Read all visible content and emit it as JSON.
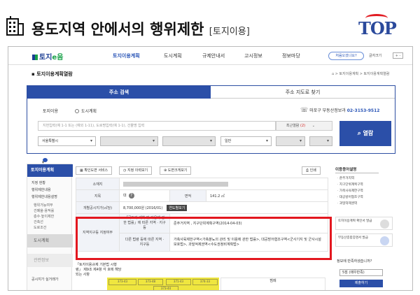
{
  "slide": {
    "title": "용도지역 안에서의 행위제한",
    "subtitle": "[토지이용]",
    "logo": "TOP"
  },
  "nav": {
    "brand_a": "토지",
    "brand_b": "e음",
    "menus": [
      "토지이용계획",
      "도시계획",
      "규제안내서",
      "고시정보",
      "정보마당"
    ],
    "active_menu": "토지이용계획",
    "pill": "처음오셨나요?",
    "font_label": "글자크기",
    "font_ctrl": "+ -"
  },
  "page": {
    "title": "토지이용계획열람",
    "breadcrumb": "⌂ > 토지이용계획 > 토지이용계획열람"
  },
  "search": {
    "tab_active": "주소 검색",
    "tab_other": "주소 지도로 찾기",
    "radio_1": "토지이용",
    "radio_2": "도시계획",
    "phone_label": "마포구 부동산정보과",
    "phone_number": "02-3153-9512",
    "address_placeholder": "지번입력(예 1-1 또는 (예외 1-11), 도로명입력(예 1-1), 건물명 입력",
    "recent_label": "최근열람",
    "recent_count": "(2)",
    "city": "서울특별시",
    "land_type": "일반",
    "button": "열람"
  },
  "sidebar": {
    "head": "토지이용계획",
    "items": [
      "지정 현황",
      "행위제한내용",
      "행위제한내용설명"
    ],
    "subitems": [
      "행위가능여부",
      "건폐율·용적률",
      "층수·높이제한",
      "건축선",
      "도로조건"
    ],
    "box_1": "도시계획",
    "box_2": "관련정보",
    "bottom": "공시지가 실거래가"
  },
  "toolbar": {
    "btn_1": "확인도면 서비스",
    "btn_2": "지정 이력보기",
    "btn_3": "도면크게보기",
    "print": "인쇄"
  },
  "info": {
    "row_addr_label": "소재지",
    "row_jimok_label": "지목",
    "jimok_value": "대",
    "area_label": "면적",
    "area_value": "141.2 ㎡",
    "price_label": "개별공시지가(㎡당)",
    "price_value": "8,700,000원 (2016/01)",
    "price_btn": "연도별보기",
    "usage_label": "지역지구등 지정여부",
    "law1_label": "「국토의 계획 및 이용에 관한 법률」에 따른 지역 · 지구등",
    "law1_value": "준주거지역 , 지구단위계획구역(2014-04-03)",
    "law2_label": "다른 법령 등에 따른 지역 · 지구등",
    "law2_value": "가축사육제한구역<가축분뇨의 관리 및 이용에 관한 법률>, 대공방어협조구역<군사기지 및 군사시설 보호법>, 과밀억제권역<수도권정비계획법>"
  },
  "legend": "「토지이용규제 기본법 시행령」 제9조 제4항 각 호에 해당되는 사항",
  "map": {
    "col_header": "범례",
    "parcels": [
      "373-43",
      "373-48",
      "371-43",
      "374-33",
      "373-44"
    ]
  },
  "right": {
    "title": "이용용어설명",
    "links": [
      "준주거지역",
      "지구단위계획구역",
      "가축사육제한구역",
      "대공방어협조구역",
      "과밀억제권역"
    ],
    "card_1": "토지이용계획 확인서 발급",
    "card_2": "부동산종합증명서 발급",
    "question": "정보에 만족하셨습니까?",
    "select": "5점 (매우만족)",
    "submit": "제출하기"
  }
}
